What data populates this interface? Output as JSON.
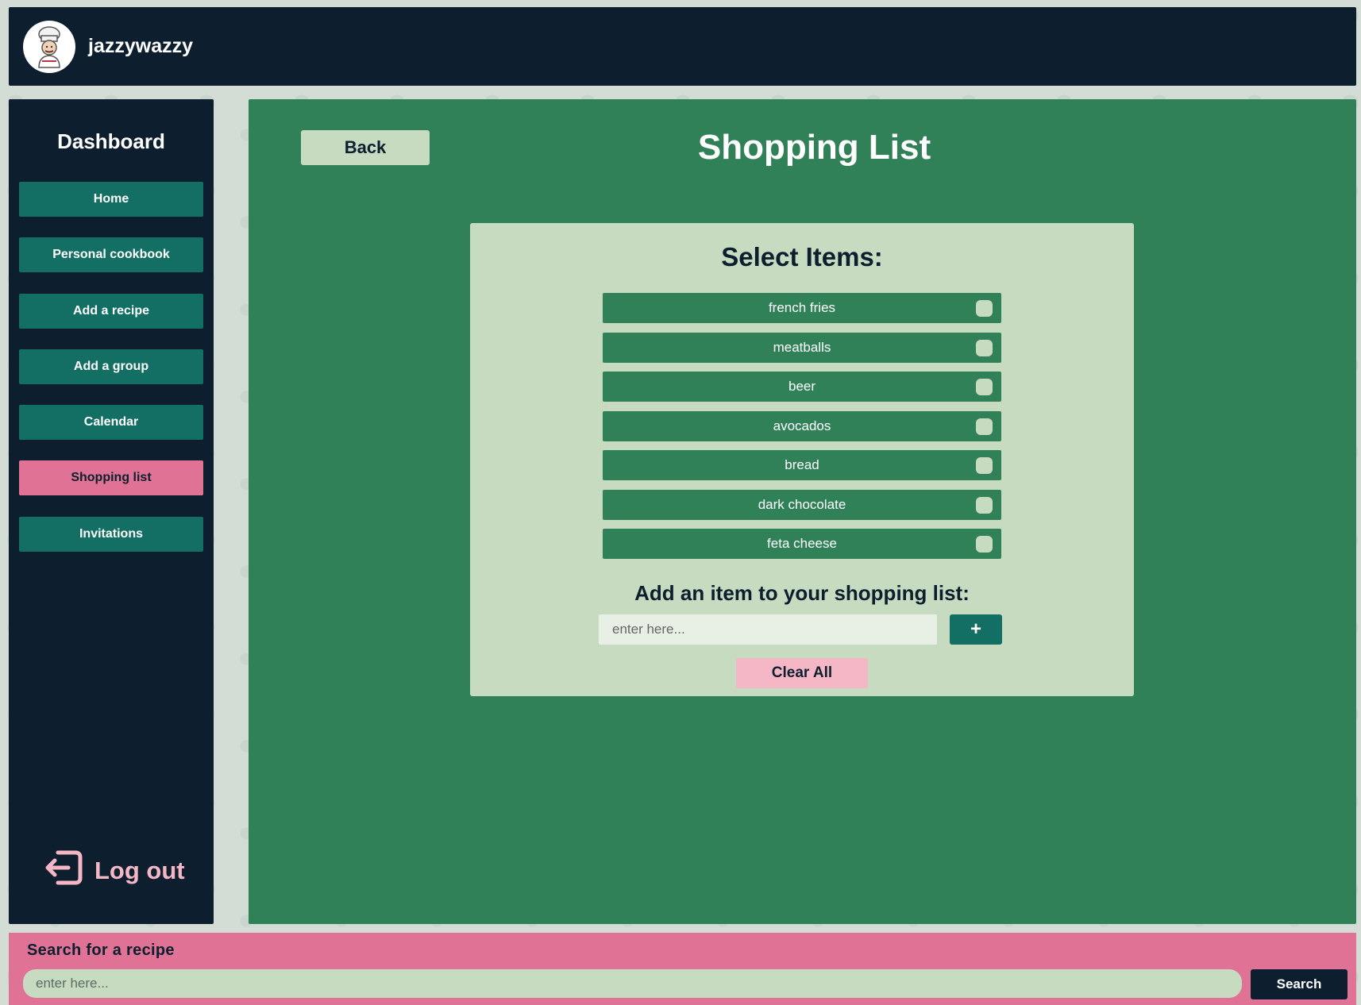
{
  "header": {
    "username": "jazzywazzy",
    "avatar_icon": "chef-avatar-icon"
  },
  "sidebar": {
    "title": "Dashboard",
    "items": [
      {
        "label": "Home",
        "active": false
      },
      {
        "label": "Personal cookbook",
        "active": false
      },
      {
        "label": "Add a recipe",
        "active": false
      },
      {
        "label": "Add a group",
        "active": false
      },
      {
        "label": "Calendar",
        "active": false
      },
      {
        "label": "Shopping list",
        "active": true
      },
      {
        "label": "Invitations",
        "active": false
      }
    ],
    "logout_label": "Log out",
    "logout_icon": "logout-icon"
  },
  "main": {
    "back_label": "Back",
    "title": "Shopping List",
    "select_title": "Select Items:",
    "items": [
      {
        "name": "french fries",
        "checked": false
      },
      {
        "name": "meatballs",
        "checked": false
      },
      {
        "name": "beer",
        "checked": false
      },
      {
        "name": "avocados",
        "checked": false
      },
      {
        "name": "bread",
        "checked": false
      },
      {
        "name": "dark chocolate",
        "checked": false
      },
      {
        "name": "feta cheese",
        "checked": false
      }
    ],
    "add_label": "Add an item to your shopping list:",
    "add_placeholder": "enter here...",
    "add_button": "+",
    "clear_label": "Clear All"
  },
  "search": {
    "label": "Search for a recipe",
    "placeholder": "enter here...",
    "button": "Search"
  },
  "colors": {
    "navy": "#0d1f2e",
    "teal": "#136f63",
    "green": "#318158",
    "sage": "#c6dbbf",
    "pink": "#e07295",
    "light_pink": "#f5b7c5"
  }
}
